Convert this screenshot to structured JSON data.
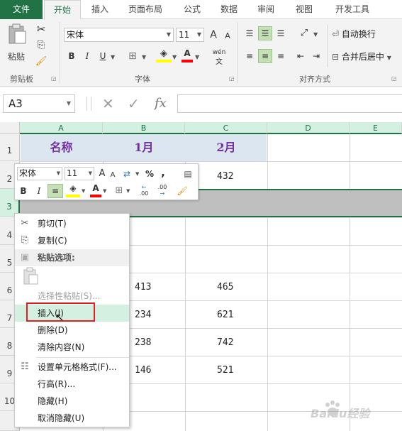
{
  "tabs": [
    {
      "label": "文件"
    },
    {
      "label": "开始"
    },
    {
      "label": "插入"
    },
    {
      "label": "页面布局"
    },
    {
      "label": "公式"
    },
    {
      "label": "数据"
    },
    {
      "label": "审阅"
    },
    {
      "label": "视图"
    },
    {
      "label": "开发工具"
    }
  ],
  "ribbon": {
    "clipboard": {
      "paste_label": "粘贴",
      "group_label": "剪贴板"
    },
    "font": {
      "name": "宋体",
      "size": "11",
      "grow": "A",
      "shrink": "A",
      "bold": "B",
      "italic": "I",
      "underline": "U",
      "font_color_glyph": "A",
      "phonetic": "wén",
      "group_label": "字体"
    },
    "alignment": {
      "wrap_text": "自动换行",
      "merge_center": "合并后居中",
      "group_label": "对齐方式"
    },
    "accent_color": "#217346"
  },
  "formula_bar": {
    "name_box": "A3",
    "cancel": "✕",
    "enter": "✓",
    "fx": "fx",
    "value": ""
  },
  "grid": {
    "columns": [
      "A",
      "B",
      "C",
      "D",
      "E"
    ],
    "rows": [
      "1",
      "2",
      "3",
      "4",
      "5",
      "6",
      "7",
      "8",
      "9",
      "10"
    ],
    "header_row": {
      "a": "名称",
      "b": "1月",
      "c": "2月"
    },
    "cells": {
      "c2": "432",
      "b6": "413",
      "c6": "465",
      "b7": "234",
      "c7": "621",
      "b8": "238",
      "c8": "742",
      "b9": "146",
      "c9": "521"
    },
    "header_fill": "#dce6f1",
    "header_text_color": "#7030a0",
    "selected_row_fill": "#bfbfbf"
  },
  "mini_toolbar": {
    "font": "宋体",
    "size": "11",
    "grow": "A",
    "shrink": "A",
    "percent": "%",
    "comma": ",",
    "bold": "B",
    "italic": "I",
    "font_color_glyph": "A",
    "inc_decimal": ".00",
    "dec_decimal": ".00"
  },
  "context_menu": {
    "cut": "剪切(T)",
    "copy": "复制(C)",
    "paste_options": "粘贴选项:",
    "paste_special": "选择性粘贴(S)...",
    "insert": "插入(I)",
    "delete": "删除(D)",
    "clear": "清除内容(N)",
    "format_cells": "设置单元格格式(F)...",
    "row_height": "行高(R)...",
    "hide": "隐藏(H)",
    "unhide": "取消隐藏(U)"
  },
  "watermark": {
    "brand": "Baidu经验"
  }
}
